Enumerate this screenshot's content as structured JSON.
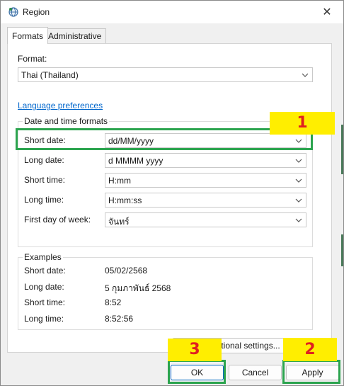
{
  "window": {
    "title": "Region",
    "close_glyph": "✕",
    "icon": "region-globe-icon"
  },
  "tabs": [
    {
      "label": "Formats",
      "active": true
    },
    {
      "label": "Administrative",
      "active": false
    }
  ],
  "formats": {
    "format_label": "Format:",
    "format_value": "Thai (Thailand)",
    "language_link": "Language preferences",
    "datetime_group_title": "Date and time formats",
    "fields": [
      {
        "label": "Short date:",
        "value": "dd/MM/yyyy"
      },
      {
        "label": "Long date:",
        "value": "d MMMM yyyy"
      },
      {
        "label": "Short time:",
        "value": "H:mm"
      },
      {
        "label": "Long time:",
        "value": "H:mm:ss"
      },
      {
        "label": "First day of week:",
        "value": "จันทร์"
      }
    ],
    "examples_title": "Examples",
    "examples": [
      {
        "label": "Short date:",
        "value": "05/02/2568"
      },
      {
        "label": "Long date:",
        "value": "5 กุมภาพันธ์ 2568"
      },
      {
        "label": "Short time:",
        "value": "8:52"
      },
      {
        "label": "Long time:",
        "value": "8:52:56"
      }
    ],
    "additional_settings": "Additional settings..."
  },
  "buttons": {
    "ok": "OK",
    "cancel": "Cancel",
    "apply": "Apply"
  },
  "annotations": [
    {
      "number": "1",
      "target": "Short date"
    },
    {
      "number": "2",
      "target": "Apply"
    },
    {
      "number": "3",
      "target": "OK"
    }
  ],
  "colors": {
    "highlight_border": "#2ca44f",
    "badge_bg": "#ffee00",
    "badge_text": "#e02020",
    "link": "#0066cc",
    "primary_button_border": "#0067c0"
  }
}
